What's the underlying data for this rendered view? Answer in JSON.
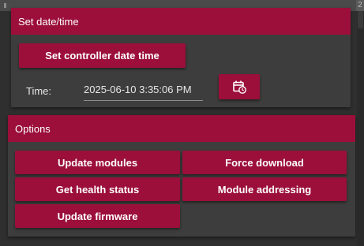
{
  "topbar": {
    "corner_text": "2"
  },
  "datetime_panel": {
    "title": "Set date/time",
    "set_button_label": "Set controller date time",
    "time_label": "Time:",
    "time_value": "2025-06-10 3:35:06 PM",
    "calendar_icon": "calendar-clock-icon"
  },
  "options_panel": {
    "title": "Options",
    "buttons": {
      "update_modules": "Update modules",
      "force_download": "Force download",
      "get_health_status": "Get health status",
      "module_addressing": "Module addressing",
      "update_firmware": "Update firmware"
    }
  },
  "colors": {
    "accent": "#9b0f3a",
    "panel_bg": "#3d3d3d",
    "page_bg": "#2f2f2f",
    "text": "#ffffff"
  }
}
